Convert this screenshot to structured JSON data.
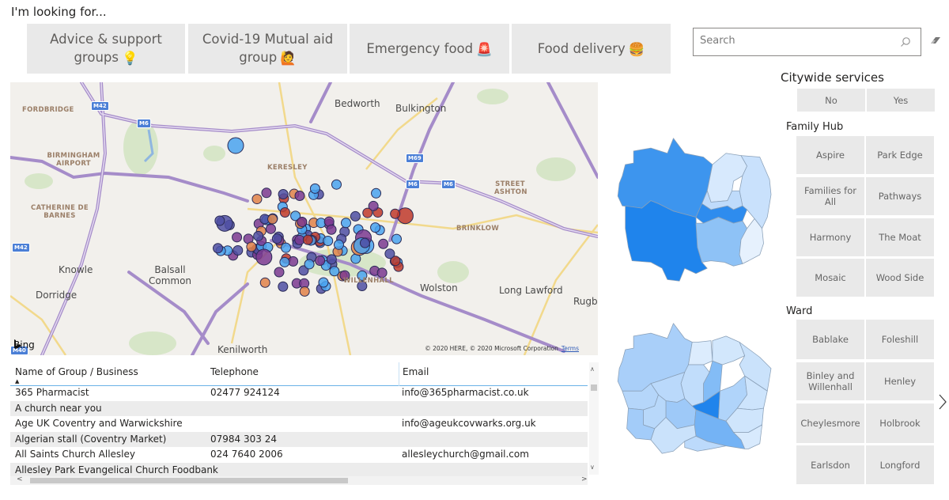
{
  "header": {
    "title": "I'm looking for..."
  },
  "categories": [
    {
      "label_line1": "Advice & support",
      "label_line2": "groups",
      "icon": "light-bulb-icon",
      "emoji": "💡"
    },
    {
      "label_line1": "Covid-19 Mutual aid",
      "label_line2": "group",
      "icon": "person-raising-hand-icon",
      "emoji": "🙋"
    },
    {
      "label_line1": "Emergency food",
      "label_line2": "",
      "icon": "police-light-icon",
      "emoji": "🚨"
    },
    {
      "label_line1": "Food delivery",
      "label_line2": "",
      "icon": "hamburger-icon",
      "emoji": "🍔"
    }
  ],
  "search": {
    "placeholder": "Search",
    "value": ""
  },
  "citywide": {
    "title": "Citywide services",
    "options": [
      "No",
      "Yes"
    ]
  },
  "family_hub": {
    "title": "Family Hub",
    "options": [
      "Aspire",
      "Park Edge",
      "Families for All",
      "Pathways",
      "Harmony",
      "The Moat",
      "Mosaic",
      "Wood Side"
    ]
  },
  "ward": {
    "title": "Ward",
    "options": [
      "Bablake",
      "Foleshill",
      "Binley and Willenhall",
      "Henley",
      "Cheylesmore",
      "Holbrook",
      "Earlsdon",
      "Longford"
    ]
  },
  "map": {
    "places": [
      {
        "name": "Bedworth",
        "caps": false
      },
      {
        "name": "Bulkington",
        "caps": false
      },
      {
        "name": "FORDBRIDGE",
        "caps": true
      },
      {
        "name": "BIRMINGHAM AIRPORT",
        "caps": true
      },
      {
        "name": "KERESLEY",
        "caps": true
      },
      {
        "name": "STREET ASHTON",
        "caps": true
      },
      {
        "name": "CATHERINE DE BARNES",
        "caps": true
      },
      {
        "name": "BRINKLOW",
        "caps": true
      },
      {
        "name": "Knowle",
        "caps": false
      },
      {
        "name": "Balsall Common",
        "caps": false
      },
      {
        "name": "Wolston",
        "caps": false
      },
      {
        "name": "Long Lawford",
        "caps": false
      },
      {
        "name": "Dorridge",
        "caps": false
      },
      {
        "name": "Rugby",
        "caps": false
      },
      {
        "name": "Kenilworth",
        "caps": false
      },
      {
        "name": "WILLENHALL",
        "caps": true
      }
    ],
    "motorways": [
      "M42",
      "M6",
      "M69",
      "M6",
      "M6",
      "M42",
      "M40"
    ],
    "provider": "Bing",
    "copyright": "© 2020 HERE, © 2020 Microsoft Corporation",
    "terms_label": "Terms",
    "colors": {
      "light_blue": "#4aa3f0",
      "navy": "#4f4fa3",
      "purple": "#7b3a91",
      "orange": "#e2824a",
      "red": "#c0392b"
    }
  },
  "table": {
    "columns": [
      "Name of Group / Business",
      "Telephone",
      "Email"
    ],
    "sorted_column": "Name of Group / Business",
    "rows": [
      [
        "365 Pharmacist",
        "02477 924124",
        "info@365pharmacist.co.uk"
      ],
      [
        "A church near you",
        "",
        ""
      ],
      [
        "Age UK Coventry and Warwickshire",
        "",
        "info@ageukcovwarks.org.uk"
      ],
      [
        "Algerian stall (Coventry Market)",
        "07984 303 24",
        ""
      ],
      [
        "All Saints Church Allesley",
        "024 7640 2006",
        "allesleychurch@gmail.com"
      ],
      [
        "Allesley Park Evangelical Church Foodbank",
        "",
        ""
      ]
    ]
  }
}
